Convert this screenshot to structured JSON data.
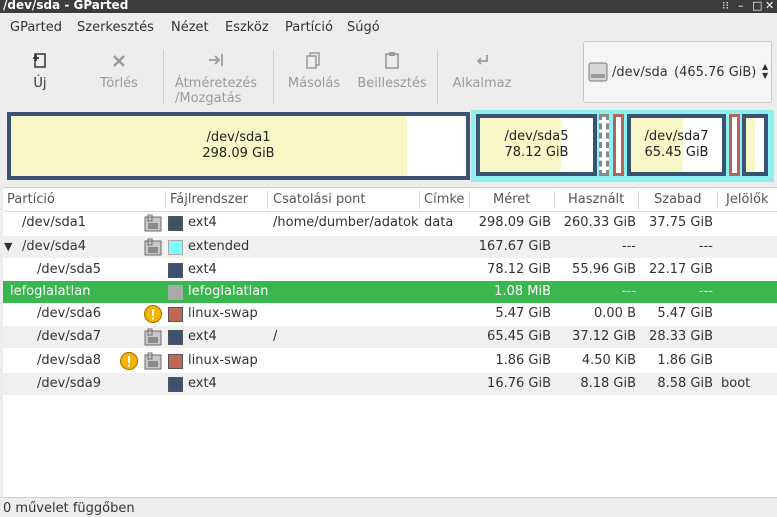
{
  "window": {
    "title": "/dev/sda - GParted"
  },
  "menu": {
    "items": [
      {
        "label": "GParted"
      },
      {
        "label": "Szerkesztés"
      },
      {
        "label": "Nézet"
      },
      {
        "label": "Eszköz"
      },
      {
        "label": "Partíció"
      },
      {
        "label": "Súgó"
      }
    ]
  },
  "toolbar": {
    "new": "Új",
    "delete": "Törlés",
    "resize_1": "Átméretezés",
    "resize_2": "/Mozgatás",
    "copy": "Másolás",
    "paste": "Beillesztés",
    "apply": "Alkalmaz"
  },
  "device": {
    "name": "/dev/sda",
    "size": "(465.76 GiB)"
  },
  "diskmap": {
    "sda1": {
      "name": "/dev/sda1",
      "size": "298.09 GiB",
      "used_fraction": 0.87
    },
    "sda5": {
      "name": "/dev/sda5",
      "size": "78.12 GiB",
      "used_fraction": 0.72
    },
    "sda7": {
      "name": "/dev/sda7",
      "size": "65.45 GiB",
      "used_fraction": 0.57
    }
  },
  "table": {
    "headers": [
      "Partíció",
      "Fájlrendszer",
      "Csatolási pont",
      "Címke",
      "Méret",
      "Használt",
      "Szabad",
      "Jelölők"
    ],
    "rows": [
      {
        "partition": "/dev/sda1",
        "fs": "ext4",
        "mount": "/home/dumber/adatok",
        "label": "data",
        "size": "298.09 GiB",
        "used": "260.33 GiB",
        "free": "37.75 GiB",
        "flags": ""
      },
      {
        "partition": "/dev/sda4",
        "fs": "extended",
        "mount": "",
        "label": "",
        "size": "167.67 GiB",
        "used": "---",
        "free": "---",
        "flags": ""
      },
      {
        "partition": "/dev/sda5",
        "fs": "ext4",
        "mount": "",
        "label": "",
        "size": "78.12 GiB",
        "used": "55.96 GiB",
        "free": "22.17 GiB",
        "flags": ""
      },
      {
        "partition": "lefoglalatlan",
        "fs": "lefoglalatlan",
        "mount": "",
        "label": "",
        "size": "1.08 MiB",
        "used": "---",
        "free": "---",
        "flags": ""
      },
      {
        "partition": "/dev/sda6",
        "fs": "linux-swap",
        "mount": "",
        "label": "",
        "size": "5.47 GiB",
        "used": "0.00 B",
        "free": "5.47 GiB",
        "flags": ""
      },
      {
        "partition": "/dev/sda7",
        "fs": "ext4",
        "mount": "/",
        "label": "",
        "size": "65.45 GiB",
        "used": "37.12 GiB",
        "free": "28.33 GiB",
        "flags": ""
      },
      {
        "partition": "/dev/sda8",
        "fs": "linux-swap",
        "mount": "",
        "label": "",
        "size": "1.86 GiB",
        "used": "4.50 KiB",
        "free": "1.86 GiB",
        "flags": ""
      },
      {
        "partition": "/dev/sda9",
        "fs": "ext4",
        "mount": "",
        "label": "",
        "size": "16.76 GiB",
        "used": "8.18 GiB",
        "free": "8.58 GiB",
        "flags": "boot"
      }
    ]
  },
  "status": {
    "text": "0 művelet függőben"
  },
  "colors": {
    "ext4": "#3b5373",
    "extended": "#7dfcfc",
    "unallocated": "#a9a9a9",
    "linux_swap": "#c1665a",
    "selected": "#39b64e",
    "used": "#f8f7c8"
  },
  "icons": {
    "lock": "lock-icon",
    "warning": "warning-icon",
    "expander": "triangle-down-icon"
  }
}
